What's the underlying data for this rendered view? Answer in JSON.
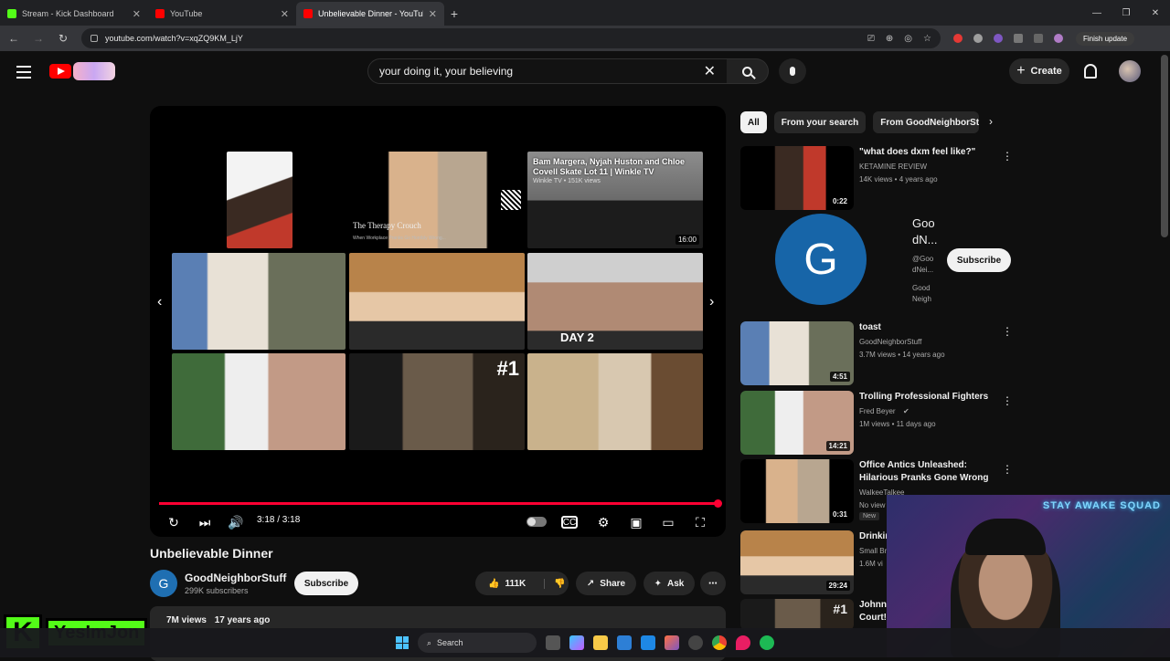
{
  "browser": {
    "tabs": [
      {
        "title": "Stream - Kick Dashboard",
        "color": "#53fc18"
      },
      {
        "title": "YouTube",
        "color": "#ff0000"
      },
      {
        "title": "Unbelievable Dinner - YouTube",
        "color": "#ff0000"
      }
    ],
    "url": "youtube.com/watch?v=xqZQ9KM_LjY",
    "finish_update": "Finish update"
  },
  "header": {
    "search_query": "your doing it, your believing",
    "create_label": "Create"
  },
  "player": {
    "endscreen": {
      "featured_title": "Bam Margera, Nyjah Huston and Chloe Covell Skate Lot 11 | Winkle TV",
      "featured_meta": "Winkle TV • 151K views",
      "featured_duration": "16:00",
      "therapy_overlay": "The Therapy Crouch",
      "therapy_sub": "When Workplace Pranks Go Horribly Wrong...",
      "day_label": "DAY 2",
      "rank_label": "#1"
    },
    "time": "3:18 / 3:18",
    "progress": 1.0
  },
  "video": {
    "title": "Unbelievable Dinner",
    "channel": "GoodNeighborStuff",
    "channel_initial": "G",
    "subscribers": "299K subscribers",
    "subscribe_label": "Subscribe",
    "likes": "111K",
    "share_label": "Share",
    "ask_label": "Ask",
    "views": "7M views",
    "age": "17 years ago"
  },
  "sidebar": {
    "chips": [
      "All",
      "From your search",
      "From GoodNeighborStuff"
    ],
    "channel_card": {
      "initial": "G",
      "name": "Goo dN...",
      "handle": "@Goo dNei...",
      "desc": "Good Neigh",
      "subscribe_label": "Subscribe"
    },
    "recs": [
      {
        "title": "\"what does dxm feel like?\"",
        "channel": "KETAMINE REVIEW",
        "meta": "14K views • 4 years ago",
        "duration": "0:22"
      },
      {
        "title": "toast",
        "channel": "GoodNeighborStuff",
        "meta": "3.7M views • 14 years ago",
        "duration": "4:51"
      },
      {
        "title": "Trolling Professional Fighters",
        "channel": "Fred Beyer",
        "meta": "1M views • 11 days ago",
        "duration": "14:21"
      },
      {
        "title": "Office Antics Unleashed: Hilarious Pranks Gone Wrong ...",
        "channel": "WalkeeTalkee",
        "meta": "No view",
        "duration": "0:31",
        "badge": "New"
      },
      {
        "title": "Drinkin",
        "channel": "Small Br",
        "meta": "1.6M vi",
        "duration": "29:24"
      },
      {
        "title": "Johnny Court!",
        "channel": "",
        "meta": "",
        "duration": ""
      }
    ]
  },
  "overlay": {
    "brand_name": "YesImJon",
    "brand_initial": "K"
  },
  "taskbar": {
    "search_label": "Search"
  }
}
